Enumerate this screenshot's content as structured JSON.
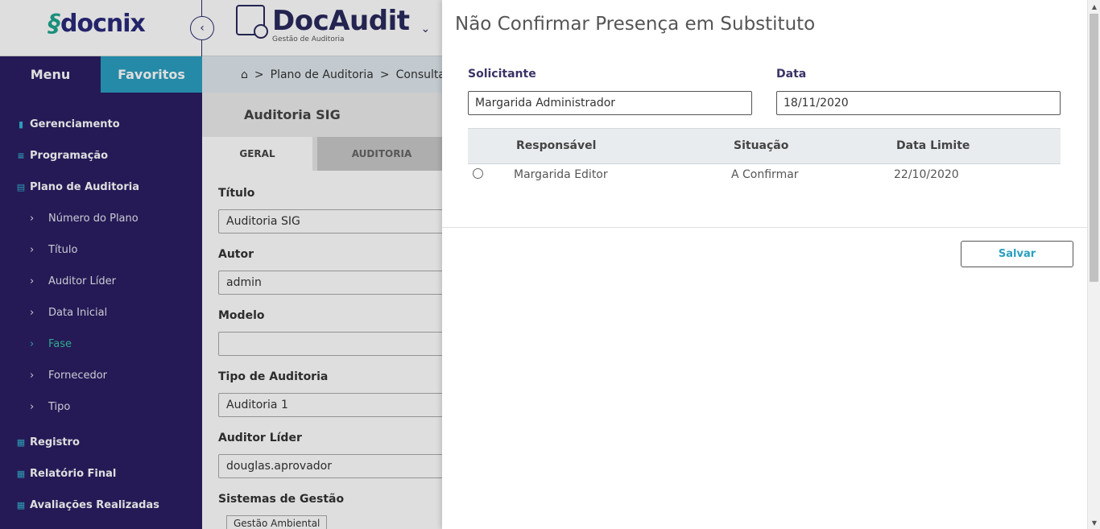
{
  "header": {
    "docnix_logo_mark": "§",
    "docnix_logo_text": "docnix",
    "collapse_icon": "‹",
    "app_name": "DocAudit",
    "app_subtitle": "Gestão de Auditoria",
    "app_caret": "⌄"
  },
  "sidebar": {
    "tab_menu": "Menu",
    "tab_favoritos": "Favoritos",
    "items": [
      {
        "label": "Gerenciamento",
        "icon": "bar-chart-icon"
      },
      {
        "label": "Programação",
        "icon": "tree-icon"
      },
      {
        "label": "Plano de Auditoria",
        "icon": "document-icon"
      },
      {
        "label": "Número do Plano",
        "icon": "chevron-right-icon"
      },
      {
        "label": "Título",
        "icon": "chevron-right-icon"
      },
      {
        "label": "Auditor Líder",
        "icon": "chevron-right-icon"
      },
      {
        "label": "Data Inicial",
        "icon": "chevron-right-icon"
      },
      {
        "label": "Fase",
        "icon": "chevron-right-icon",
        "active": true
      },
      {
        "label": "Fornecedor",
        "icon": "chevron-right-icon"
      },
      {
        "label": "Tipo",
        "icon": "chevron-right-icon"
      },
      {
        "label": "Registro",
        "icon": "register-icon"
      },
      {
        "label": "Relatório Final",
        "icon": "report-icon"
      },
      {
        "label": "Avaliações Realizadas",
        "icon": "evaluation-icon"
      }
    ],
    "active_color": "#35c4a0",
    "bg_color": "#2b1e63",
    "fav_color": "#2a9fc0"
  },
  "breadcrumb": {
    "home_icon": "⌂",
    "sep1": ">",
    "item1": "Plano de Auditoria",
    "sep2": ">",
    "item2": "Consultar"
  },
  "main": {
    "subheader": "Auditoria SIG",
    "tab_geral": "GERAL",
    "tab_auditoria": "AUDITORIA",
    "fields": {
      "titulo_label": "Título",
      "titulo_value": "Auditoria SIG",
      "autor_label": "Autor",
      "autor_value": "admin",
      "modelo_label": "Modelo",
      "modelo_value": "",
      "tipo_label": "Tipo de Auditoria",
      "tipo_value": "Auditoria 1",
      "auditor_label": "Auditor Líder",
      "auditor_value": "douglas.aprovador",
      "sistemas_label": "Sistemas de Gestão",
      "sistemas_chip": "Gestão Ambiental"
    }
  },
  "panel": {
    "title": "Não Confirmar Presença em Substituto",
    "solicitante_label": "Solicitante",
    "solicitante_value": "Margarida Administrador",
    "data_label": "Data",
    "data_value": "18/11/2020",
    "table": {
      "headers": [
        "Responsável",
        "Situação",
        "Data Limite"
      ],
      "rows": [
        {
          "responsavel": "Margarida Editor",
          "situacao": "A Confirmar",
          "data_limite": "22/10/2020",
          "selected": false
        }
      ]
    },
    "save_label": "Salvar",
    "accent_color": "#2a9fc0"
  },
  "scrollbar": {
    "up_icon": "▲",
    "down_icon": "▼"
  }
}
